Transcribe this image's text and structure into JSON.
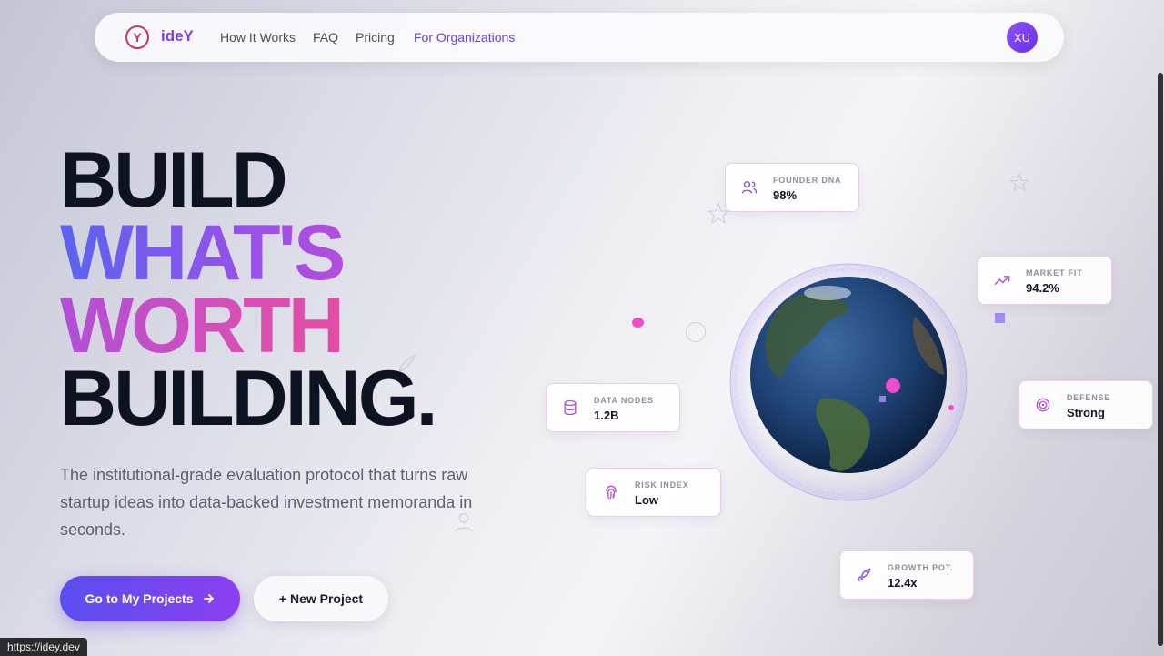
{
  "nav": {
    "logo_glyph": "Y",
    "brand": "ideY",
    "links": [
      "How It Works",
      "FAQ",
      "Pricing",
      "For Organizations"
    ],
    "avatar_initials": "XU"
  },
  "hero": {
    "line1": "BUILD",
    "line2": "WHAT'S",
    "line3": "WORTH",
    "line4": "BUILDING.",
    "subtitle": "The institutional-grade evaluation protocol that turns raw startup ideas into data-backed investment memoranda in seconds."
  },
  "actions": {
    "primary_label": "Go to My Projects",
    "secondary_label": "+ New Project"
  },
  "metrics": {
    "founder_dna": {
      "label": "FOUNDER DNA",
      "value": "98%",
      "icon": "users-icon"
    },
    "market_fit": {
      "label": "MARKET FIT",
      "value": "94.2%",
      "icon": "trending-up-icon"
    },
    "data_nodes": {
      "label": "DATA NODES",
      "value": "1.2B",
      "icon": "database-icon"
    },
    "defense": {
      "label": "DEFENSE",
      "value": "Strong",
      "icon": "target-icon"
    },
    "risk_index": {
      "label": "RISK INDEX",
      "value": "Low",
      "icon": "fingerprint-icon"
    },
    "growth": {
      "label": "GROWTH POT.",
      "value": "12.4x",
      "icon": "rocket-icon"
    }
  },
  "status_url": "https://idey.dev",
  "colors": {
    "accent": "#7b3fe4",
    "pink": "#ee4b8e",
    "dark": "#0e1321"
  }
}
